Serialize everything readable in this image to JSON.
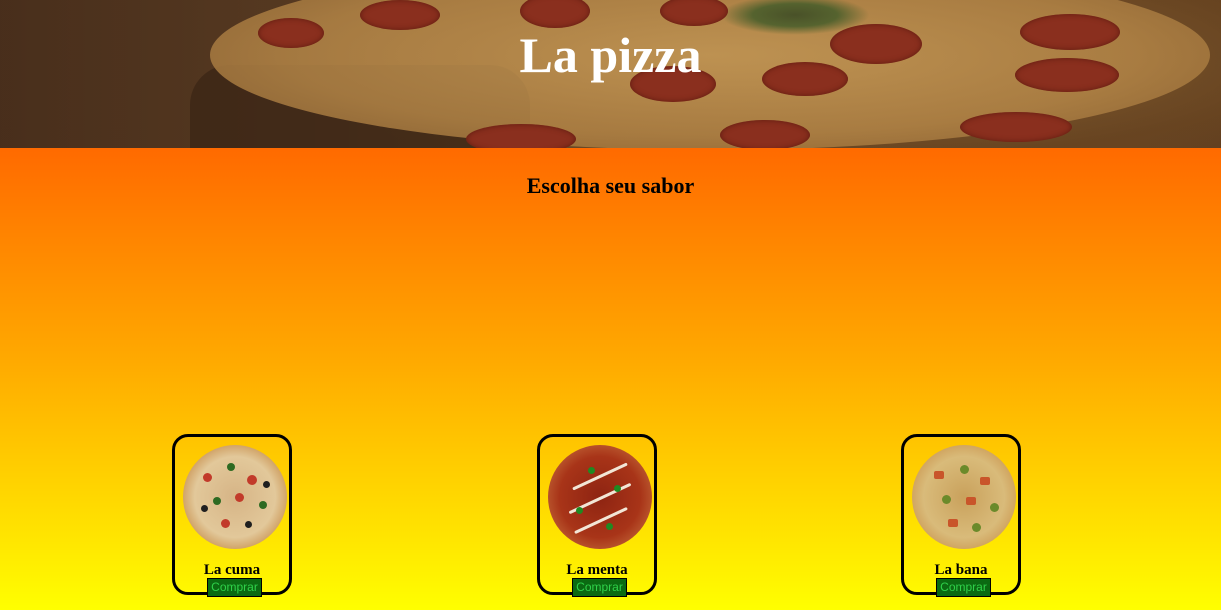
{
  "header": {
    "title": "La pizza"
  },
  "main": {
    "heading": "Escolha seu sabor"
  },
  "products": [
    {
      "name": "La cuma",
      "button_label": "Comprar"
    },
    {
      "name": "La menta",
      "button_label": "Comprar"
    },
    {
      "name": "La bana",
      "button_label": "Comprar"
    }
  ],
  "colors": {
    "gradient_top": "#ff6a00",
    "gradient_bottom": "#ffff00",
    "button_bg": "#0b6a12",
    "button_text": "#2fd14a"
  }
}
